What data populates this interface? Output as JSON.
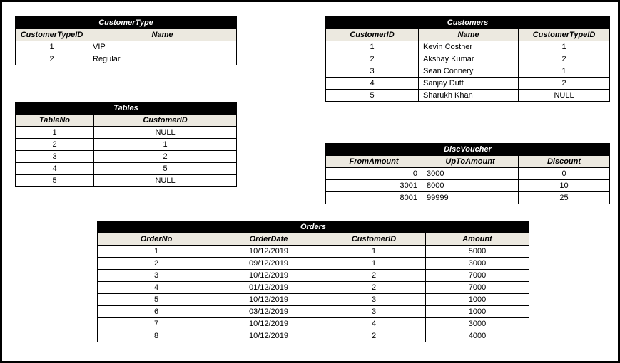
{
  "customerType": {
    "title": "CustomerType",
    "columns": [
      "CustomerTypeID",
      "Name"
    ],
    "rows": [
      {
        "id": "1",
        "name": "VIP"
      },
      {
        "id": "2",
        "name": "Regular"
      }
    ]
  },
  "customers": {
    "title": "Customers",
    "columns": [
      "CustomerID",
      "Name",
      "CustomerTypeID"
    ],
    "rows": [
      {
        "id": "1",
        "name": "Kevin Costner",
        "type": "1"
      },
      {
        "id": "2",
        "name": "Akshay Kumar",
        "type": "2"
      },
      {
        "id": "3",
        "name": "Sean Connery",
        "type": "1"
      },
      {
        "id": "4",
        "name": "Sanjay Dutt",
        "type": "2"
      },
      {
        "id": "5",
        "name": "Sharukh Khan",
        "type": "NULL"
      }
    ]
  },
  "tables": {
    "title": "Tables",
    "columns": [
      "TableNo",
      "CustomerID"
    ],
    "rows": [
      {
        "no": "1",
        "cust": "NULL"
      },
      {
        "no": "2",
        "cust": "1"
      },
      {
        "no": "3",
        "cust": "2"
      },
      {
        "no": "4",
        "cust": "5"
      },
      {
        "no": "5",
        "cust": "NULL"
      }
    ]
  },
  "discVoucher": {
    "title": "DiscVoucher",
    "columns": [
      "FromAmount",
      "UpToAmount",
      "Discount"
    ],
    "rows": [
      {
        "from": "0",
        "upto": "3000",
        "disc": "0"
      },
      {
        "from": "3001",
        "upto": "8000",
        "disc": "10"
      },
      {
        "from": "8001",
        "upto": "99999",
        "disc": "25"
      }
    ]
  },
  "orders": {
    "title": "Orders",
    "columns": [
      "OrderNo",
      "OrderDate",
      "CustomerID",
      "Amount"
    ],
    "rows": [
      {
        "no": "1",
        "date": "10/12/2019",
        "cust": "1",
        "amt": "5000"
      },
      {
        "no": "2",
        "date": "09/12/2019",
        "cust": "1",
        "amt": "3000"
      },
      {
        "no": "3",
        "date": "10/12/2019",
        "cust": "2",
        "amt": "7000"
      },
      {
        "no": "4",
        "date": "01/12/2019",
        "cust": "2",
        "amt": "7000"
      },
      {
        "no": "5",
        "date": "10/12/2019",
        "cust": "3",
        "amt": "1000"
      },
      {
        "no": "6",
        "date": "03/12/2019",
        "cust": "3",
        "amt": "1000"
      },
      {
        "no": "7",
        "date": "10/12/2019",
        "cust": "4",
        "amt": "3000"
      },
      {
        "no": "8",
        "date": "10/12/2019",
        "cust": "2",
        "amt": "4000"
      }
    ]
  }
}
